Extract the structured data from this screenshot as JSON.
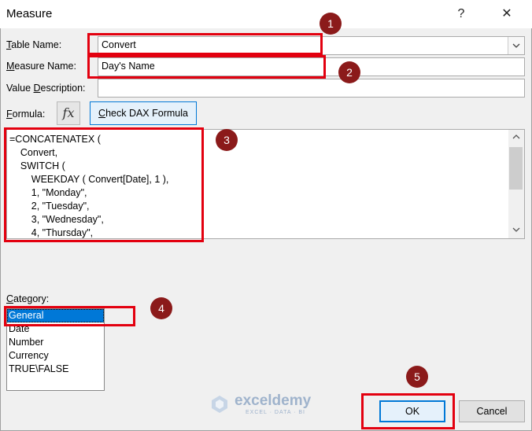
{
  "window": {
    "title": "Measure",
    "help_glyph": "?",
    "close_glyph": "✕"
  },
  "fields": {
    "table_name_label": "Table Name:",
    "table_name_value": "Convert",
    "measure_name_label": "Measure Name:",
    "measure_name_value": "Day's Name",
    "value_description_label": "Value Description:",
    "value_description_value": "",
    "formula_label": "Formula:",
    "fx_label": "fx",
    "check_dax_label": "Check DAX Formula"
  },
  "formula_lines": [
    "=CONCATENATEX (",
    "    Convert,",
    "    SWITCH (",
    "        WEEKDAY ( Convert[Date], 1 ),",
    "        1, \"Monday\",",
    "        2, \"Tuesday\",",
    "        3, \"Wednesday\",",
    "        4, \"Thursday\","
  ],
  "category": {
    "label": "Category:",
    "items": [
      "General",
      "Date",
      "Number",
      "Currency",
      "TRUE\\FALSE"
    ],
    "selected": "General"
  },
  "buttons": {
    "ok_label": "OK",
    "cancel_label": "Cancel"
  },
  "annotations": {
    "badges": [
      "1",
      "2",
      "3",
      "4",
      "5"
    ],
    "highlight_color": "#e3000f",
    "badge_color": "#8b1a1a"
  },
  "watermark": {
    "brand": "exceldemy",
    "tagline": "EXCEL · DATA · BI"
  }
}
